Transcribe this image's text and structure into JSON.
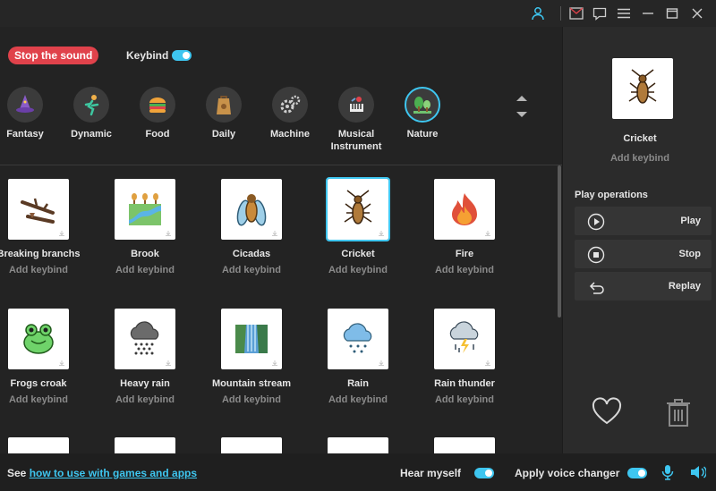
{
  "titlebar": {
    "icons": [
      "user-icon",
      "mail-icon",
      "chat-icon",
      "menu-icon",
      "minimize-icon",
      "maximize-icon",
      "close-icon"
    ]
  },
  "controls": {
    "stop_label": "Stop the sound",
    "keybind_label": "Keybind",
    "keybind_enabled": true
  },
  "categories": [
    {
      "label": "Fantasy",
      "icon": "wizard-hat-icon"
    },
    {
      "label": "Dynamic",
      "icon": "runner-icon"
    },
    {
      "label": "Food",
      "icon": "burger-icon"
    },
    {
      "label": "Daily",
      "icon": "bag-icon"
    },
    {
      "label": "Machine",
      "icon": "gears-icon"
    },
    {
      "label": "Musical Instrument",
      "icon": "piano-icon"
    },
    {
      "label": "Nature",
      "icon": "trees-icon",
      "active": true
    }
  ],
  "sounds": [
    {
      "name": "Breaking branchs",
      "keybind": "Add keybind",
      "icon": "branch-icon"
    },
    {
      "name": "Brook",
      "keybind": "Add keybind",
      "icon": "brook-icon"
    },
    {
      "name": "Cicadas",
      "keybind": "Add keybind",
      "icon": "cicada-icon"
    },
    {
      "name": "Cricket",
      "keybind": "Add keybind",
      "icon": "cricket-icon",
      "selected": true
    },
    {
      "name": "Fire",
      "keybind": "Add keybind",
      "icon": "fire-icon"
    },
    {
      "name": "Frogs croak",
      "keybind": "Add keybind",
      "icon": "frog-icon"
    },
    {
      "name": "Heavy rain",
      "keybind": "Add keybind",
      "icon": "heavy-rain-icon"
    },
    {
      "name": "Mountain stream",
      "keybind": "Add keybind",
      "icon": "waterfall-icon"
    },
    {
      "name": "Rain",
      "keybind": "Add keybind",
      "icon": "rain-icon"
    },
    {
      "name": "Rain thunder",
      "keybind": "Add keybind",
      "icon": "thunder-icon"
    }
  ],
  "selected": {
    "name": "Cricket",
    "keybind": "Add keybind",
    "icon": "cricket-icon"
  },
  "operations": {
    "title": "Play operations",
    "play": "Play",
    "stop": "Stop",
    "replay": "Replay"
  },
  "bottom": {
    "see_prefix": "See ",
    "link_text": "how to use with games and apps",
    "hear_myself": "Hear myself",
    "hear_myself_on": true,
    "apply_voice_changer": "Apply voice changer",
    "apply_voice_changer_on": true
  },
  "colors": {
    "accent": "#3ec6f0",
    "stop_button": "#e0424b"
  }
}
